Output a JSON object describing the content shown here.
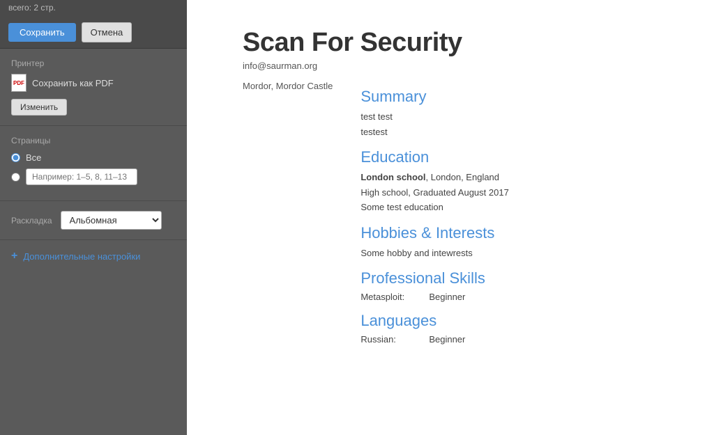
{
  "topbar": {
    "note": "всего: 2 стр.",
    "save_label": "Сохранить",
    "cancel_label": "Отмена"
  },
  "printer": {
    "label": "Принтер",
    "name": "Сохранить как PDF",
    "change_label": "Изменить"
  },
  "pages": {
    "label": "Страницы",
    "all_label": "Все",
    "range_placeholder": "Например: 1–5, 8, 11–13"
  },
  "layout": {
    "label": "Раскладка",
    "option": "Альбомная"
  },
  "advanced": {
    "label": "Дополнительные настройки"
  },
  "cv": {
    "name": "Scan For Security",
    "email": "info@saurman.org",
    "address": "Mordor, Mordor Castle",
    "summary": {
      "title": "Summary",
      "lines": [
        "test test",
        "testest"
      ]
    },
    "education": {
      "title": "Education",
      "lines": [
        {
          "bold": "London school",
          "rest": ", London, England"
        },
        {
          "bold": "",
          "rest": "High school, Graduated August 2017"
        },
        {
          "bold": "",
          "rest": "Some test education"
        }
      ]
    },
    "hobbies": {
      "title": "Hobbies & Interests",
      "text": "Some hobby and intewrests"
    },
    "professional_skills": {
      "title": "Professional Skills",
      "skills": [
        {
          "name": "Metasploit:",
          "level": "Beginner"
        }
      ]
    },
    "languages": {
      "title": "Languages",
      "skills": [
        {
          "name": "Russian:",
          "level": "Beginner"
        }
      ]
    }
  }
}
